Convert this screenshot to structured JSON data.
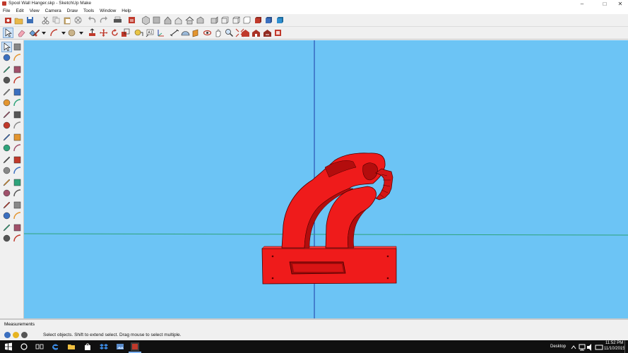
{
  "window": {
    "title": "Spool Wall Hanger.skp - SketchUp Make",
    "controls": [
      "–",
      "□",
      "✕"
    ]
  },
  "menu": [
    "File",
    "Edit",
    "View",
    "Camera",
    "Draw",
    "Tools",
    "Window",
    "Help"
  ],
  "toolbar1": [
    "getting-started",
    "open",
    "save",
    "cut",
    "copy",
    "paste",
    "erase",
    "undo",
    "redo",
    "print",
    "model-info",
    "iso",
    "top",
    "front",
    "right",
    "back",
    "left",
    "xray",
    "back-edges",
    "wireframe",
    "hidden-line",
    "shaded",
    "shaded-texture",
    "monochrome"
  ],
  "toolbar2": [
    "select",
    "eraser",
    "paint",
    "line",
    "arc",
    "shape",
    "push-pull",
    "move",
    "rotate",
    "scale",
    "tape",
    "text",
    "axes",
    "dimension",
    "protractor",
    "section",
    "orbit",
    "pan",
    "zoom",
    "zoom-extents",
    "warehouse",
    "share",
    "extension",
    "layout"
  ],
  "left_tools": [
    "select",
    "make-component",
    "paint-bucket",
    "eraser",
    "line",
    "freehand",
    "rectangle",
    "rotated-rectangle",
    "circle",
    "polygon",
    "arc",
    "2pt-arc",
    "3pt-arc",
    "pie",
    "move",
    "push-pull",
    "rotate",
    "follow-me",
    "scale",
    "offset",
    "tape-measure",
    "dimension",
    "protractor",
    "text",
    "axes",
    "3d-text",
    "orbit",
    "pan",
    "zoom",
    "zoom-window",
    "zoom-extents",
    "previous",
    "position-camera",
    "look-around",
    "walk",
    "section-plane"
  ],
  "colors": {
    "sky": "#6cc4f5",
    "model": "#ef1b1b",
    "model_shade": "#b30d0d",
    "green_axis": "#2ea37a",
    "blue_axis": "#1c3aa8"
  },
  "measurements": {
    "label": "Measurements"
  },
  "status": {
    "hint": "Select objects. Shift to extend select. Drag mouse to select multiple."
  },
  "taskbar": {
    "desktop_label": "Desktop",
    "time": "11:52 PM",
    "date": "11/10/2015"
  }
}
